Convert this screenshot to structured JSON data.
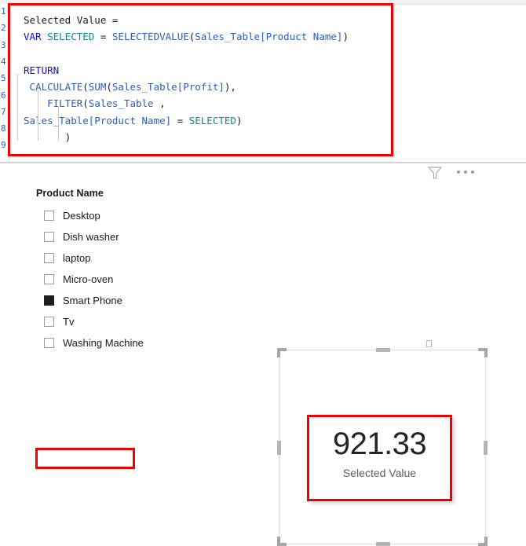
{
  "formula": {
    "line_numbers": [
      "1",
      "2",
      "3",
      "4",
      "5",
      "6",
      "7",
      "8",
      "9"
    ],
    "lines": [
      {
        "n": "1",
        "tokens": [
          {
            "t": "Selected Value =",
            "c": "plain"
          }
        ]
      },
      {
        "n": "2",
        "tokens": [
          {
            "t": "VAR",
            "c": "kw"
          },
          {
            "t": " ",
            "c": "plain"
          },
          {
            "t": "SELECTED",
            "c": "var"
          },
          {
            "t": " = ",
            "c": "plain"
          },
          {
            "t": "SELECTEDVALUE",
            "c": "fn"
          },
          {
            "t": "(",
            "c": "plain"
          },
          {
            "t": "Sales_Table[Product Name]",
            "c": "tbl"
          },
          {
            "t": ")",
            "c": "plain"
          }
        ]
      },
      {
        "n": "3",
        "tokens": []
      },
      {
        "n": "4",
        "tokens": [
          {
            "t": "RETURN",
            "c": "kw"
          }
        ]
      },
      {
        "n": "5",
        "tokens": [
          {
            "t": " ",
            "c": "plain"
          },
          {
            "t": "CALCULATE",
            "c": "fn"
          },
          {
            "t": "(",
            "c": "plain"
          },
          {
            "t": "SUM",
            "c": "fn"
          },
          {
            "t": "(",
            "c": "plain"
          },
          {
            "t": "Sales_Table[Profit]",
            "c": "tbl"
          },
          {
            "t": "),",
            "c": "plain"
          }
        ]
      },
      {
        "n": "6",
        "tokens": [
          {
            "t": "    ",
            "c": "plain"
          },
          {
            "t": "FILTER",
            "c": "fn"
          },
          {
            "t": "(",
            "c": "plain"
          },
          {
            "t": "Sales_Table",
            "c": "tbl"
          },
          {
            "t": " ,",
            "c": "plain"
          }
        ]
      },
      {
        "n": "7",
        "tokens": [
          {
            "t": "Sales_Table[Product Name]",
            "c": "tbl"
          },
          {
            "t": " = ",
            "c": "plain"
          },
          {
            "t": "SELECTED",
            "c": "var"
          },
          {
            "t": ")",
            "c": "plain"
          }
        ]
      },
      {
        "n": "8",
        "tokens": [
          {
            "t": "       ",
            "c": "plain"
          },
          {
            "t": ")",
            "c": "plain"
          }
        ]
      },
      {
        "n": "9",
        "tokens": []
      }
    ],
    "measure_name": "Selected Value",
    "highlight_color": "#ee0000"
  },
  "visual_header": {
    "filter_icon": "filter-funnel-icon",
    "more_options_icon": "more-options-icon"
  },
  "slicer": {
    "title": "Product Name",
    "items": [
      {
        "label": "Desktop",
        "checked": false
      },
      {
        "label": "Dish washer",
        "checked": false
      },
      {
        "label": "laptop",
        "checked": false
      },
      {
        "label": "Micro-oven",
        "checked": false
      },
      {
        "label": "Smart Phone",
        "checked": true
      },
      {
        "label": "Tv",
        "checked": false
      },
      {
        "label": "Washing Machine",
        "checked": false
      }
    ],
    "highlighted_item": "Smart Phone",
    "highlight_color": "#ee0000"
  },
  "card_visual": {
    "value": "921.33",
    "label": "Selected Value",
    "selected": true,
    "highlight_color": "#ee0000"
  }
}
